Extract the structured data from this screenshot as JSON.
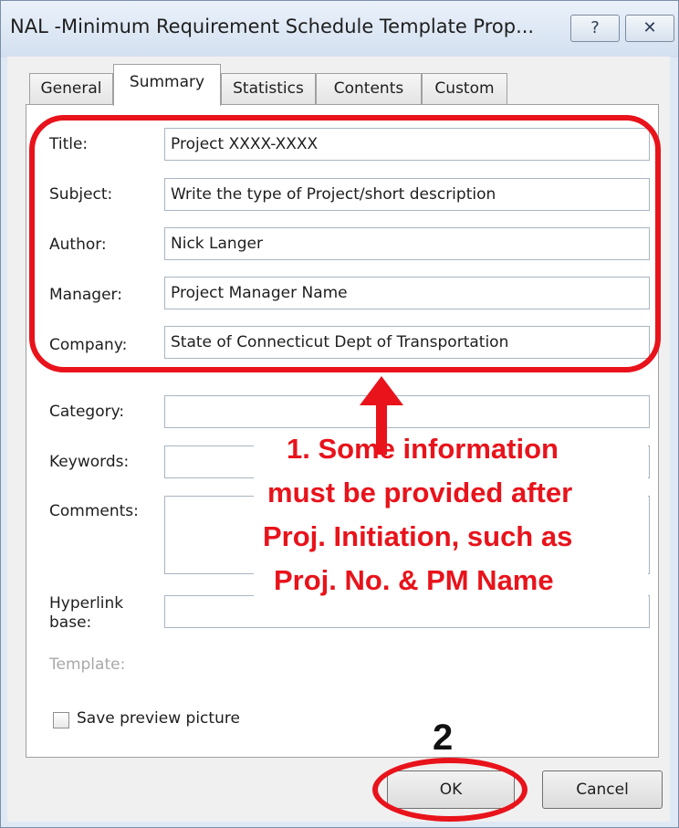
{
  "window": {
    "title": "NAL -Minimum Requirement Schedule Template Prop...",
    "help_glyph": "?",
    "close_glyph": "✕"
  },
  "tabs": [
    {
      "label": "General",
      "active": false
    },
    {
      "label": "Summary",
      "active": true
    },
    {
      "label": "Statistics",
      "active": false
    },
    {
      "label": "Contents",
      "active": false
    },
    {
      "label": "Custom",
      "active": false
    }
  ],
  "fields": {
    "title": {
      "label": "Title:",
      "value": "Project XXXX-XXXX"
    },
    "subject": {
      "label": "Subject:",
      "value": "Write the type of Project/short description"
    },
    "author": {
      "label": "Author:",
      "value": "Nick Langer"
    },
    "manager": {
      "label": "Manager:",
      "value": "Project Manager Name"
    },
    "company": {
      "label": "Company:",
      "value": "State of Connecticut Dept of Transportation"
    },
    "category": {
      "label": "Category:",
      "value": ""
    },
    "keywords": {
      "label": "Keywords:",
      "value": ""
    },
    "comments": {
      "label": "Comments:",
      "value": ""
    },
    "hyperlink": {
      "label_line1": "Hyperlink",
      "label_line2": "base:",
      "value": ""
    },
    "template": {
      "label": "Template:"
    }
  },
  "save_preview": {
    "label": "Save preview picture",
    "checked": false
  },
  "buttons": {
    "ok": "OK",
    "cancel": "Cancel"
  },
  "annotations": {
    "note_lines": [
      "1. Some information",
      "must be provided after",
      "Proj. Initiation, such as",
      "Proj. No. & PM Name"
    ],
    "step_two": "2",
    "color": "#e8131b"
  }
}
